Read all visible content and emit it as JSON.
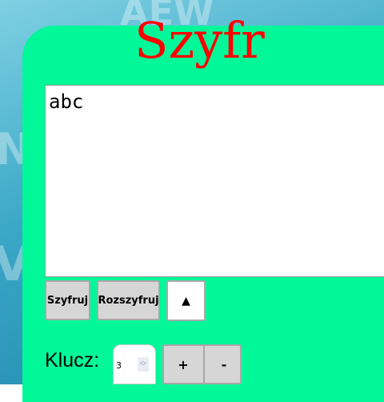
{
  "app": {
    "title": "Szyfr"
  },
  "colors": {
    "panel_background": "#00f898",
    "title": "#ff0000",
    "button_background": "#d6d6d6",
    "page_background": "#2b9cc1"
  },
  "editor": {
    "value": "abc"
  },
  "buttons": {
    "encrypt_label": "Szyfruj",
    "decrypt_label": "Rozszyfruj",
    "toggle_label": "▲"
  },
  "key": {
    "label": "Klucz:",
    "value": "3",
    "increment_label": "+",
    "decrement_label": "-"
  },
  "icons": {
    "toggle": "triangle-up-icon",
    "spinner_up": "chevron-up-icon",
    "spinner_down": "chevron-down-icon"
  }
}
